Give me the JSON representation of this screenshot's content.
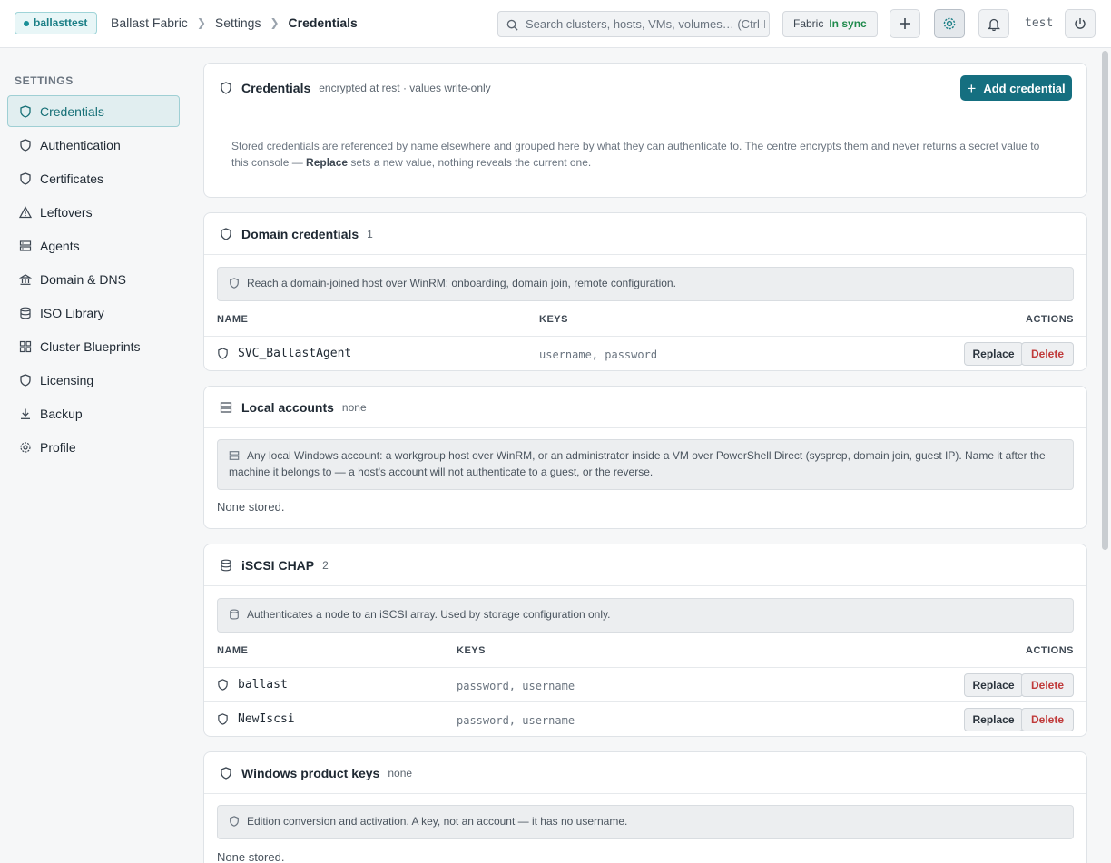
{
  "topbar": {
    "env": "ballasttest",
    "breadcrumbs": [
      "Ballast Fabric",
      "Settings",
      "Credentials"
    ],
    "search_placeholder": "Search clusters, hosts, VMs, volumes… (Ctrl-K)",
    "sync_label": "Fabric",
    "sync_status": "In sync",
    "user": "test"
  },
  "sidebar": {
    "heading": "SETTINGS",
    "items": [
      {
        "label": "Credentials",
        "icon": "shield-icon"
      },
      {
        "label": "Authentication",
        "icon": "shield-icon"
      },
      {
        "label": "Certificates",
        "icon": "shield-icon"
      },
      {
        "label": "Leftovers",
        "icon": "warning-icon"
      },
      {
        "label": "Agents",
        "icon": "server-icon"
      },
      {
        "label": "Domain & DNS",
        "icon": "building-icon"
      },
      {
        "label": "ISO Library",
        "icon": "database-icon"
      },
      {
        "label": "Cluster Blueprints",
        "icon": "grid-icon"
      },
      {
        "label": "Licensing",
        "icon": "shield-icon"
      },
      {
        "label": "Backup",
        "icon": "download-icon"
      },
      {
        "label": "Profile",
        "icon": "gear-icon"
      }
    ]
  },
  "credentials": {
    "title": "Credentials",
    "subtitle": "encrypted at rest · values write-only",
    "add_label": "Add credential",
    "intro_before": "Stored credentials are referenced by name elsewhere and grouped here by what they can authenticate to. The centre encrypts them and never returns a secret value to this console — ",
    "intro_bold": "Replace",
    "intro_after": " sets a new value, nothing reveals the current one."
  },
  "domain": {
    "title": "Domain credentials",
    "count": "1",
    "note": "Reach a domain-joined host over WinRM: onboarding, domain join, remote configuration.",
    "columns": [
      "NAME",
      "KEYS",
      "ACTIONS"
    ],
    "rows": [
      {
        "name": "SVC_BallastAgent",
        "keys": "username, password"
      }
    ]
  },
  "local": {
    "title": "Local accounts",
    "count": "none",
    "note": "Any local Windows account: a workgroup host over WinRM, or an administrator inside a VM over PowerShell Direct (sysprep, domain join, guest IP). Name it after the machine it belongs to — a host's account will not authenticate to a guest, or the reverse.",
    "empty": "None stored."
  },
  "iscsi": {
    "title": "iSCSI CHAP",
    "count": "2",
    "note": "Authenticates a node to an iSCSI array. Used by storage configuration only.",
    "columns": [
      "NAME",
      "KEYS",
      "ACTIONS"
    ],
    "rows": [
      {
        "name": "ballast",
        "keys": "password, username"
      },
      {
        "name": "NewIscsi",
        "keys": "password, username"
      }
    ]
  },
  "product": {
    "title": "Windows product keys",
    "count": "none",
    "note": "Edition conversion and activation. A key, not an account — it has no username.",
    "empty": "None stored."
  },
  "actions": {
    "replace": "Replace",
    "delete": "Delete"
  },
  "colors": {
    "accent": "#156f80",
    "danger": "#c03a3a",
    "ok": "#1f8a4c"
  }
}
